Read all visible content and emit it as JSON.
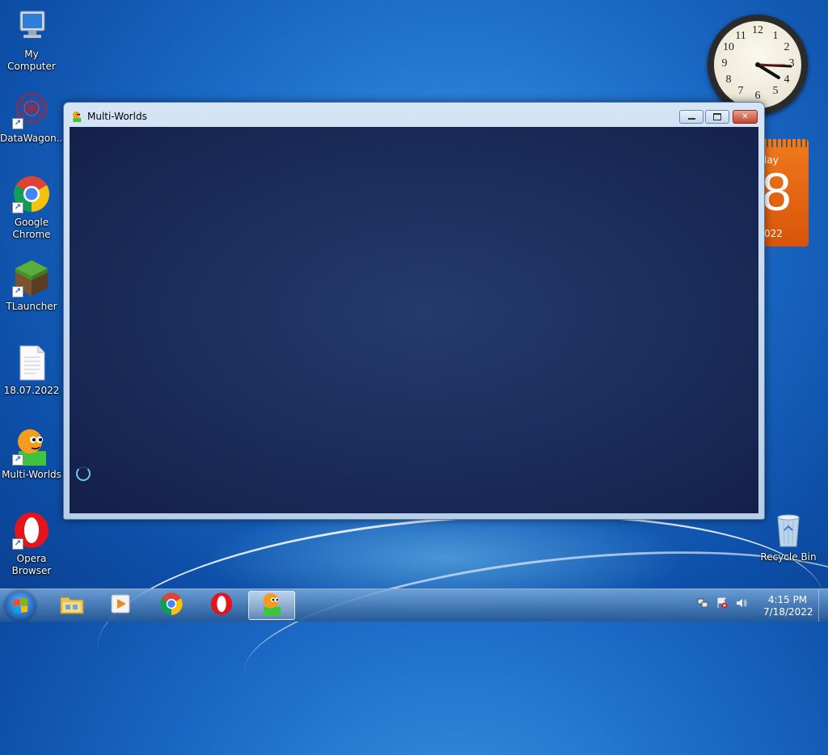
{
  "desktop": {
    "icons": [
      {
        "label": "My Computer",
        "icon": "computer-icon"
      },
      {
        "label": "DataWagon...",
        "icon": "datawagon-icon"
      },
      {
        "label": "Google Chrome",
        "icon": "chrome-icon"
      },
      {
        "label": "TLauncher",
        "icon": "tlauncher-icon"
      },
      {
        "label": "18.07.2022",
        "icon": "text-file-icon"
      },
      {
        "label": "Multi-Worlds",
        "icon": "multi-worlds-icon"
      },
      {
        "label": "Opera Browser",
        "icon": "opera-icon"
      },
      {
        "label": "Recycle Bin",
        "icon": "recycle-bin-icon"
      }
    ]
  },
  "window": {
    "title": "Multi-Worlds",
    "icon": "multi-worlds-icon",
    "controls": {
      "minimize": "minimize-icon",
      "maximize": "maximize-icon",
      "close": "close-icon"
    },
    "status": "loading-spinner"
  },
  "gadgets": {
    "clock": {
      "numbers": [
        "12",
        "1",
        "2",
        "3",
        "4",
        "5",
        "6",
        "7",
        "8",
        "9",
        "10",
        "11"
      ],
      "time": "4:15"
    },
    "calendar": {
      "day": "lay",
      "date": "8",
      "year": "022"
    }
  },
  "taskbar": {
    "pinned": [
      {
        "name": "explorer-icon"
      },
      {
        "name": "media-player-icon"
      },
      {
        "name": "chrome-icon"
      },
      {
        "name": "opera-icon"
      },
      {
        "name": "multi-worlds-icon",
        "active": true
      }
    ],
    "tray": [
      "network-icon",
      "action-center-icon",
      "volume-icon"
    ],
    "time": "4:15 PM",
    "date": "7/18/2022"
  }
}
